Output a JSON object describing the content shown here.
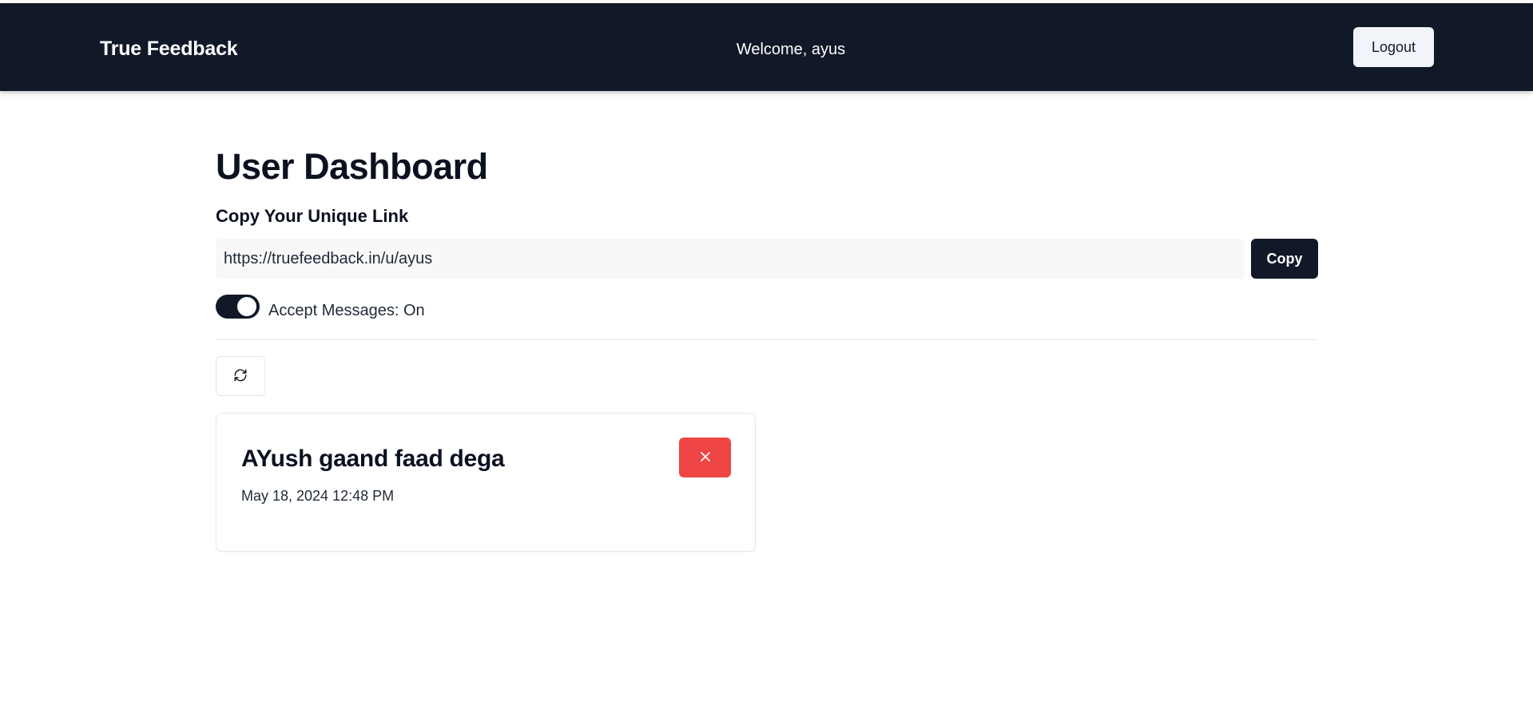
{
  "navbar": {
    "brand": "True Feedback",
    "welcome": "Welcome, ayus",
    "logout_label": "Logout"
  },
  "dashboard": {
    "title": "User Dashboard",
    "link_section_title": "Copy Your Unique Link",
    "unique_link": "https://truefeedback.in/u/ayus",
    "copy_label": "Copy",
    "accept_messages_label": "Accept Messages: ",
    "accept_messages_state": "On",
    "accept_messages_enabled": true
  },
  "messages": [
    {
      "content": "AYush gaand faad dega",
      "date": "May 18, 2024 12:48 PM"
    }
  ],
  "icons": {
    "refresh": "refresh-icon",
    "delete": "close-icon"
  },
  "colors": {
    "navbar_bg": "#111827",
    "primary": "#111827",
    "danger": "#ef4444"
  }
}
